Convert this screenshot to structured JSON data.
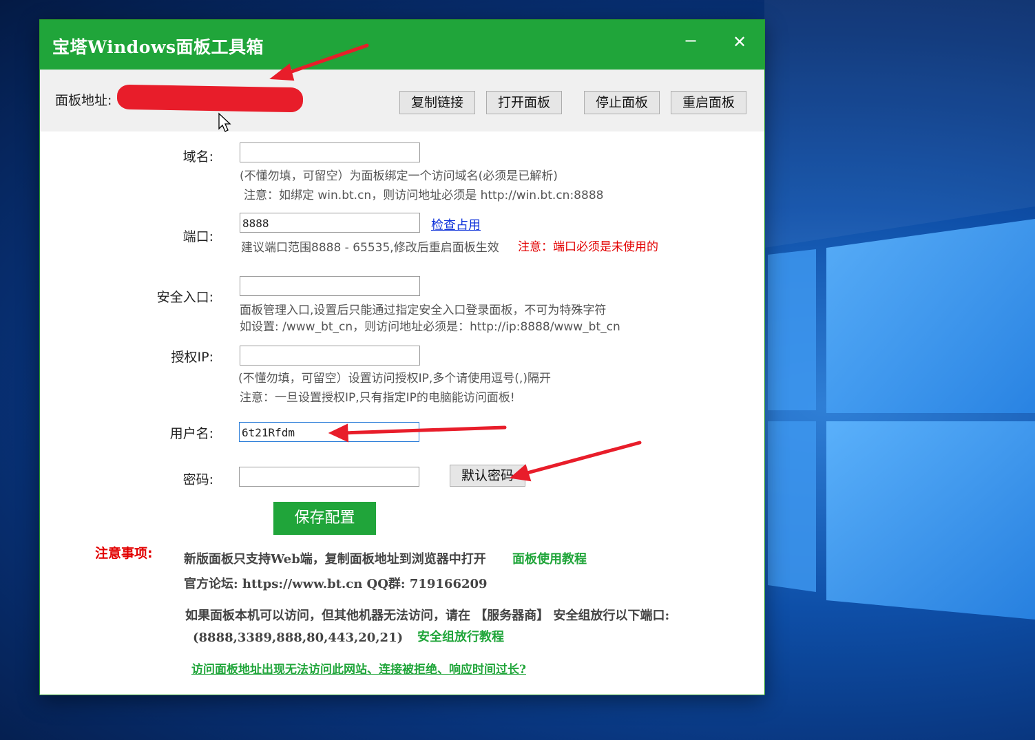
{
  "window": {
    "title": "宝塔Windows面板工具箱",
    "minimize": "−",
    "close": "✕"
  },
  "topbar": {
    "address_label": "面板地址:",
    "buttons": [
      "复制链接",
      "打开面板",
      "停止面板",
      "重启面板"
    ]
  },
  "form": {
    "domain": {
      "label": "域名:",
      "value": "",
      "hint1": "(不懂勿填，可留空）为面板绑定一个访问域名(必须是已解析)",
      "hint2": "注意：如绑定 win.bt.cn，则访问地址必须是 http://win.bt.cn:8888"
    },
    "port": {
      "label": "端口:",
      "value": "8888",
      "check_link": "检查占用",
      "hint": "建议端口范围8888 - 65535,修改后重启面板生效",
      "warning": "注意：端口必须是未使用的"
    },
    "entry": {
      "label": "安全入口:",
      "value": "",
      "hint1": "面板管理入口,设置后只能通过指定安全入口登录面板，不可为特殊字符",
      "hint2": "如设置: /www_bt_cn，则访问地址必须是：http://ip:8888/www_bt_cn"
    },
    "auth_ip": {
      "label": "授权IP:",
      "value": "",
      "hint1": "(不懂勿填，可留空）设置访问授权IP,多个请使用逗号(,)隔开",
      "hint2": "注意：一旦设置授权IP,只有指定IP的电脑能访问面板!"
    },
    "username": {
      "label": "用户名:",
      "value": "6t21Rfdm"
    },
    "password": {
      "label": "密码:",
      "value": "",
      "default_button": "默认密码"
    },
    "save_button": "保存配置"
  },
  "notice": {
    "title": "注意事项:",
    "line1": "新版面板只支持Web端，复制面板地址到浏览器中打开",
    "line1_link": "面板使用教程",
    "line2": "官方论坛: https://www.bt.cn   QQ群: 719166209",
    "line3": "如果面板本机可以访问，但其他机器无法访问，请在 【服务器商】 安全组放行以下端口:",
    "line4": "(8888,3389,888,80,443,20,21)",
    "line4_link": "安全组放行教程",
    "bottom_link": "访问面板地址出现无法访问此网站、连接被拒绝、响应时间过长?"
  },
  "colors": {
    "brand_green": "#20a53a",
    "warning_red": "#e20000",
    "annotation_red": "#e81d2a",
    "link_blue": "#0b2fd9"
  }
}
